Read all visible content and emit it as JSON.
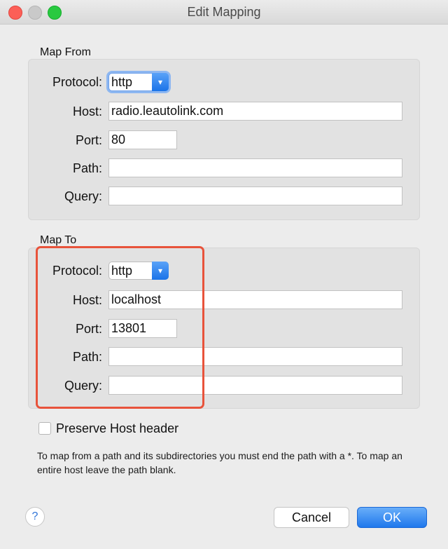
{
  "window": {
    "title": "Edit Mapping"
  },
  "map_from": {
    "label": "Map From",
    "protocol_label": "Protocol:",
    "protocol_value": "http",
    "host_label": "Host:",
    "host_value": "radio.leautolink.com",
    "port_label": "Port:",
    "port_value": "80",
    "path_label": "Path:",
    "path_value": "",
    "query_label": "Query:",
    "query_value": ""
  },
  "map_to": {
    "label": "Map To",
    "protocol_label": "Protocol:",
    "protocol_value": "http",
    "host_label": "Host:",
    "host_value": "localhost",
    "port_label": "Port:",
    "port_value": "13801",
    "path_label": "Path:",
    "path_value": "",
    "query_label": "Query:",
    "query_value": ""
  },
  "preserve_host": {
    "label": "Preserve Host header",
    "checked": false
  },
  "note": "To map from a path and its subdirectories you must end the path with a *. To map an entire host leave the path blank.",
  "buttons": {
    "help": "?",
    "cancel": "Cancel",
    "ok": "OK"
  },
  "colors": {
    "accent": "#1f78ec",
    "highlight": "#e8533b"
  }
}
